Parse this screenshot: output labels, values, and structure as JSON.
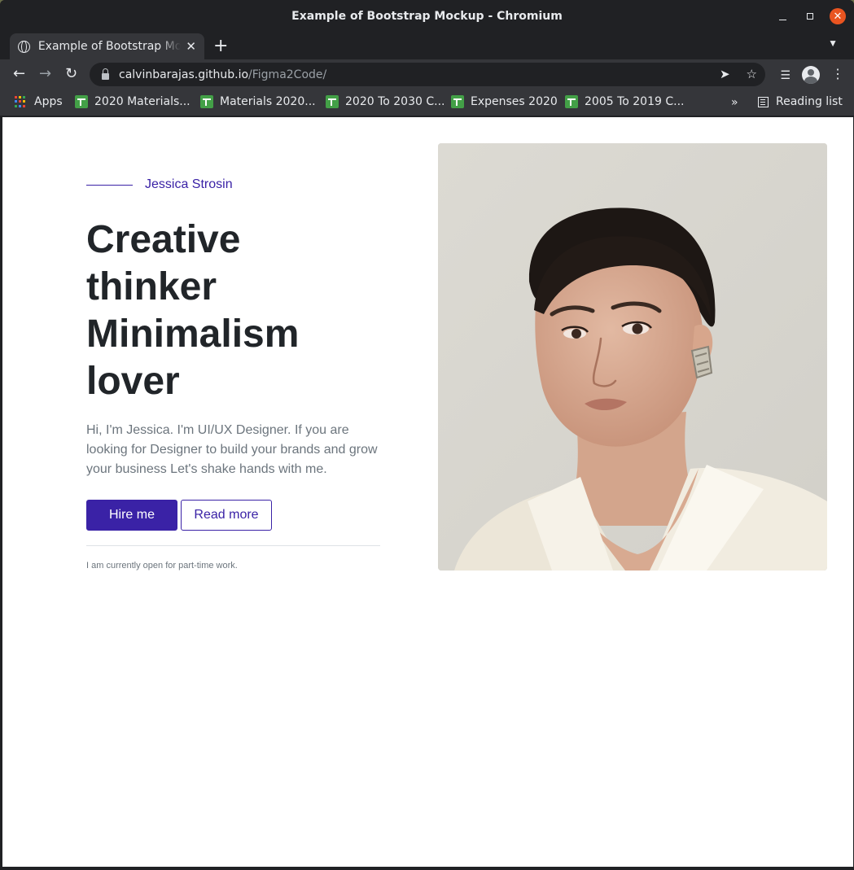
{
  "window": {
    "title": "Example of Bootstrap Mockup - Chromium"
  },
  "tab": {
    "title": "Example of Bootstrap Mockup - Chromium",
    "close_glyph": "✕",
    "new_tab_glyph": "+"
  },
  "address_bar": {
    "host": "calvinbarajas.github.io",
    "path": "/Figma2Code/"
  },
  "bookmarks": {
    "apps_label": "Apps",
    "items": [
      {
        "label": "2020 Materials..."
      },
      {
        "label": "Materials 2020..."
      },
      {
        "label": "2020 To 2030 C..."
      },
      {
        "label": "Expenses 2020"
      },
      {
        "label": "2005 To 2019 C..."
      }
    ],
    "more_glyph": "»",
    "reading_list_label": "Reading list"
  },
  "hero": {
    "eyebrow_name": "Jessica Strosin",
    "headline_lines": [
      "Creative",
      "thinker",
      "Minimalism",
      "lover"
    ],
    "intro": "Hi, I'm Jessica. I'm UI/UX Designer. If you are looking for Designer to build your brands and grow your business Let's shake hands with me.",
    "primary_button": "Hire me",
    "secondary_button": "Read more",
    "note": "I am currently open for part-time work."
  },
  "colors": {
    "accent": "#3a22a6",
    "chrome_dark": "#202124",
    "chrome_toolbar": "#35363a",
    "close_button": "#e95420"
  }
}
